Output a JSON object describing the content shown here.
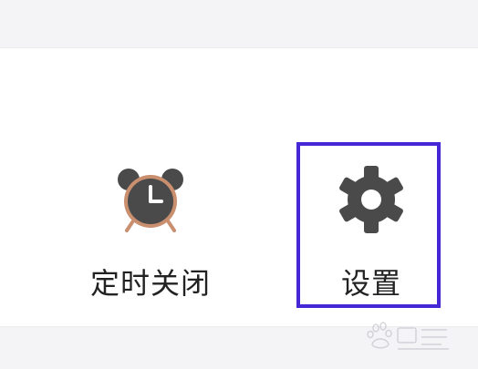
{
  "menu": {
    "items": [
      {
        "label": "定时关闭",
        "icon": "alarm-clock-icon"
      },
      {
        "label": "设置",
        "icon": "gear-icon"
      }
    ]
  },
  "colors": {
    "highlight": "#4527d6",
    "icon_dark": "#4a4a4a",
    "clock_bell_rim": "#c98f6f"
  },
  "watermark": {
    "icon": "baidu-jingyan-watermark"
  }
}
